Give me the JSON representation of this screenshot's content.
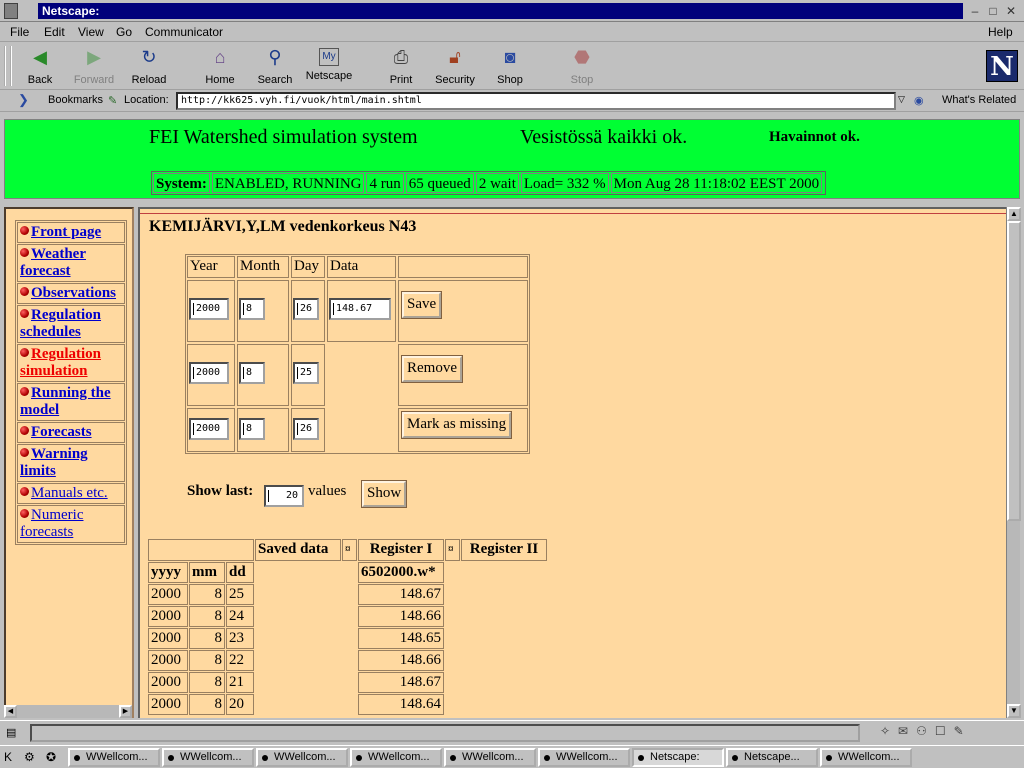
{
  "window": {
    "title": "Netscape:"
  },
  "menu": [
    "File",
    "Edit",
    "View",
    "Go",
    "Communicator",
    "Help"
  ],
  "toolbar": {
    "back": "Back",
    "forward": "Forward",
    "reload": "Reload",
    "home": "Home",
    "search": "Search",
    "netscape": "Netscape",
    "print": "Print",
    "security": "Security",
    "shop": "Shop",
    "stop": "Stop"
  },
  "location": {
    "bookmarks_label": "Bookmarks",
    "location_label": "Location:",
    "url": "http://kk625.vyh.fi/vuok/html/main.shtml",
    "whats_related": "What's Related"
  },
  "banner": {
    "title": "FEI Watershed simulation system",
    "status1": "Vesistössä kaikki ok.",
    "status2": "Havainnot ok.",
    "system": {
      "label": "System:",
      "state": "ENABLED, RUNNING",
      "run": "4 run",
      "queued": "65 queued",
      "wait": "2 wait",
      "load": "Load= 332 %",
      "time": "Mon Aug 28 11:18:02 EEST 2000"
    }
  },
  "sidebar": {
    "items": [
      {
        "label": "Front page"
      },
      {
        "label": "Weather forecast"
      },
      {
        "label": "Observations"
      },
      {
        "label": "Regulation schedules"
      },
      {
        "label": "Regulation simulation"
      },
      {
        "label": "Running the model"
      },
      {
        "label": "Forecasts"
      },
      {
        "label": "Warning limits"
      },
      {
        "label": "Manuals etc."
      },
      {
        "label": "Numeric forecasts"
      }
    ]
  },
  "main": {
    "title": "KEMIJÄRVI,Y,LM vedenkorkeus N43",
    "edit": {
      "headers": [
        "Year",
        "Month",
        "Day",
        "Data"
      ],
      "rows": [
        {
          "year": "2000",
          "month": "8",
          "day": "26",
          "data": "148.67",
          "button": "Save"
        },
        {
          "year": "2000",
          "month": "8",
          "day": "25",
          "button": "Remove"
        },
        {
          "year": "2000",
          "month": "8",
          "day": "26",
          "button": "Mark as missing"
        }
      ]
    },
    "show": {
      "label": "Show last:",
      "value": "20",
      "suffix": "values",
      "button": "Show"
    },
    "table": {
      "group_headers": {
        "saved": "Saved data",
        "mark1": "¤",
        "reg1": "Register I",
        "mark2": "¤",
        "reg2": "Register II"
      },
      "col_headers": {
        "y": "yyyy",
        "m": "mm",
        "d": "dd",
        "reg1": "6502000.w*"
      },
      "rows": [
        {
          "y": "2000",
          "m": "8",
          "d": "25",
          "v": "148.67"
        },
        {
          "y": "2000",
          "m": "8",
          "d": "24",
          "v": "148.66"
        },
        {
          "y": "2000",
          "m": "8",
          "d": "23",
          "v": "148.65"
        },
        {
          "y": "2000",
          "m": "8",
          "d": "22",
          "v": "148.66"
        },
        {
          "y": "2000",
          "m": "8",
          "d": "21",
          "v": "148.67"
        },
        {
          "y": "2000",
          "m": "8",
          "d": "20",
          "v": "148.64"
        }
      ]
    }
  },
  "taskbar": {
    "items": [
      "WWellcom...",
      "WWellcom...",
      "WWellcom...",
      "WWellcom...",
      "WWellcom...",
      "WWellcom...",
      "Netscape:",
      "Netscape...",
      "WWellcom..."
    ]
  }
}
